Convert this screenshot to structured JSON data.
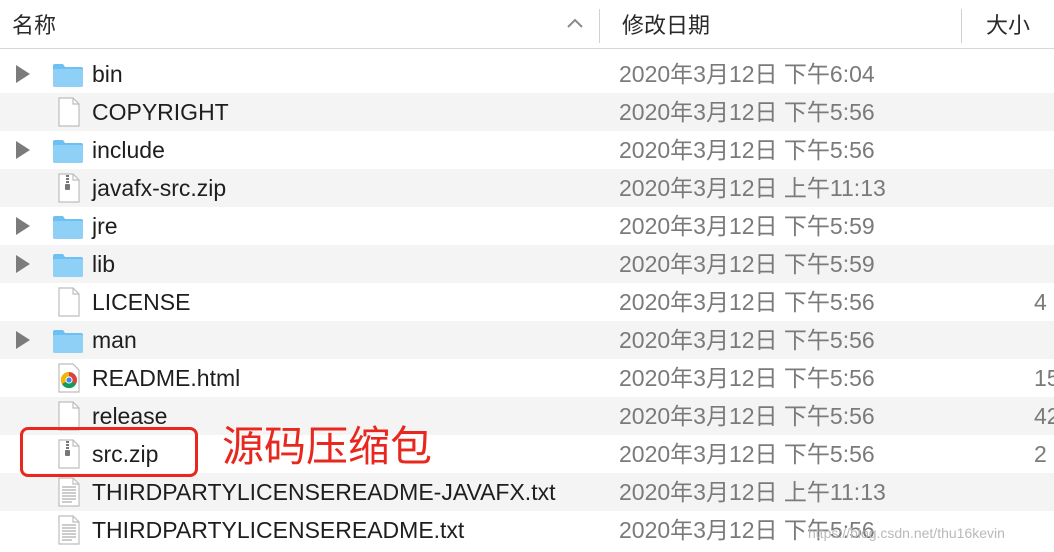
{
  "header": {
    "name_label": "名称",
    "date_label": "修改日期",
    "size_label": "大小"
  },
  "files": [
    {
      "name": "bin",
      "date": "2020年3月12日 下午6:04",
      "size": "",
      "type": "folder",
      "expandable": true
    },
    {
      "name": "COPYRIGHT",
      "date": "2020年3月12日 下午5:56",
      "size": "",
      "type": "document",
      "expandable": false
    },
    {
      "name": "include",
      "date": "2020年3月12日 下午5:56",
      "size": "",
      "type": "folder",
      "expandable": true
    },
    {
      "name": "javafx-src.zip",
      "date": "2020年3月12日 上午11:13",
      "size": "",
      "type": "zip",
      "expandable": false
    },
    {
      "name": "jre",
      "date": "2020年3月12日 下午5:59",
      "size": "",
      "type": "folder",
      "expandable": true
    },
    {
      "name": "lib",
      "date": "2020年3月12日 下午5:59",
      "size": "",
      "type": "folder",
      "expandable": true
    },
    {
      "name": "LICENSE",
      "date": "2020年3月12日 下午5:56",
      "size": "4",
      "type": "document",
      "expandable": false
    },
    {
      "name": "man",
      "date": "2020年3月12日 下午5:56",
      "size": "",
      "type": "folder",
      "expandable": true
    },
    {
      "name": "README.html",
      "date": "2020年3月12日 下午5:56",
      "size": "15",
      "type": "html",
      "expandable": false
    },
    {
      "name": "release",
      "date": "2020年3月12日 下午5:56",
      "size": "42",
      "type": "document",
      "expandable": false
    },
    {
      "name": "src.zip",
      "date": "2020年3月12日 下午5:56",
      "size": "2",
      "type": "zip",
      "expandable": false
    },
    {
      "name": "THIRDPARTYLICENSEREADME-JAVAFX.txt",
      "date": "2020年3月12日 上午11:13",
      "size": "",
      "type": "text",
      "expandable": false
    },
    {
      "name": "THIRDPARTYLICENSEREADME.txt",
      "date": "2020年3月12日 下午5:56",
      "size": "",
      "type": "text",
      "expandable": false
    }
  ],
  "annotation": {
    "text": "源码压缩包",
    "color": "#e8281e"
  },
  "watermark": "https://blog.csdn.net/thu16kevin",
  "colors": {
    "folder": "#6cc0f2",
    "alt_row": "#f4f4f5"
  }
}
